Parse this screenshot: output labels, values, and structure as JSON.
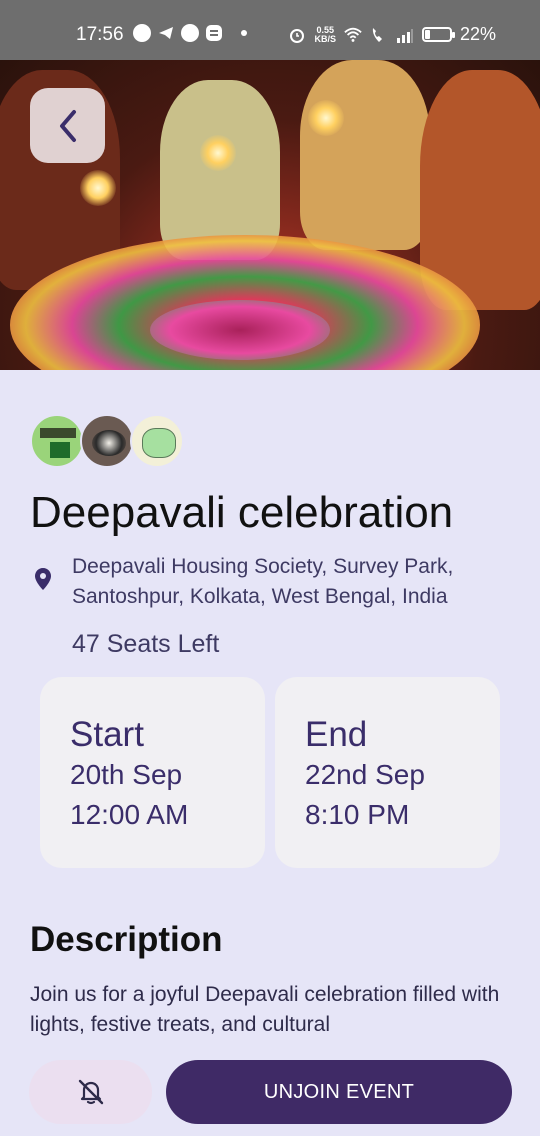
{
  "status_bar": {
    "time": "17:56",
    "net_speed_value": "0.55",
    "net_speed_unit": "KB/S",
    "battery_percent_label": "22%",
    "battery_level": 0.22
  },
  "header": {
    "back_icon": "chevron-left-icon"
  },
  "event": {
    "title": "Deepavali celebration",
    "location_icon": "location-pin-icon",
    "location": "Deepavali Housing Society, Survey Park, Santoshpur, Kolkata, West Bengal, India",
    "seats_left": "47 Seats Left",
    "start": {
      "label": "Start",
      "date": "20th Sep",
      "time": "12:00 AM"
    },
    "end": {
      "label": "End",
      "date": "22nd Sep",
      "time": "8:10 PM"
    },
    "description_heading": "Description",
    "description": "Join us for a joyful Deepavali celebration filled with lights, festive treats, and cultural"
  },
  "actions": {
    "notify_icon": "bell-off-icon",
    "unjoin_label": "UNJOIN EVENT"
  },
  "colors": {
    "background": "#e6e5f7",
    "primary": "#3f2a66",
    "card": "#f1f0f3",
    "notify_bg": "#ebdff0"
  }
}
